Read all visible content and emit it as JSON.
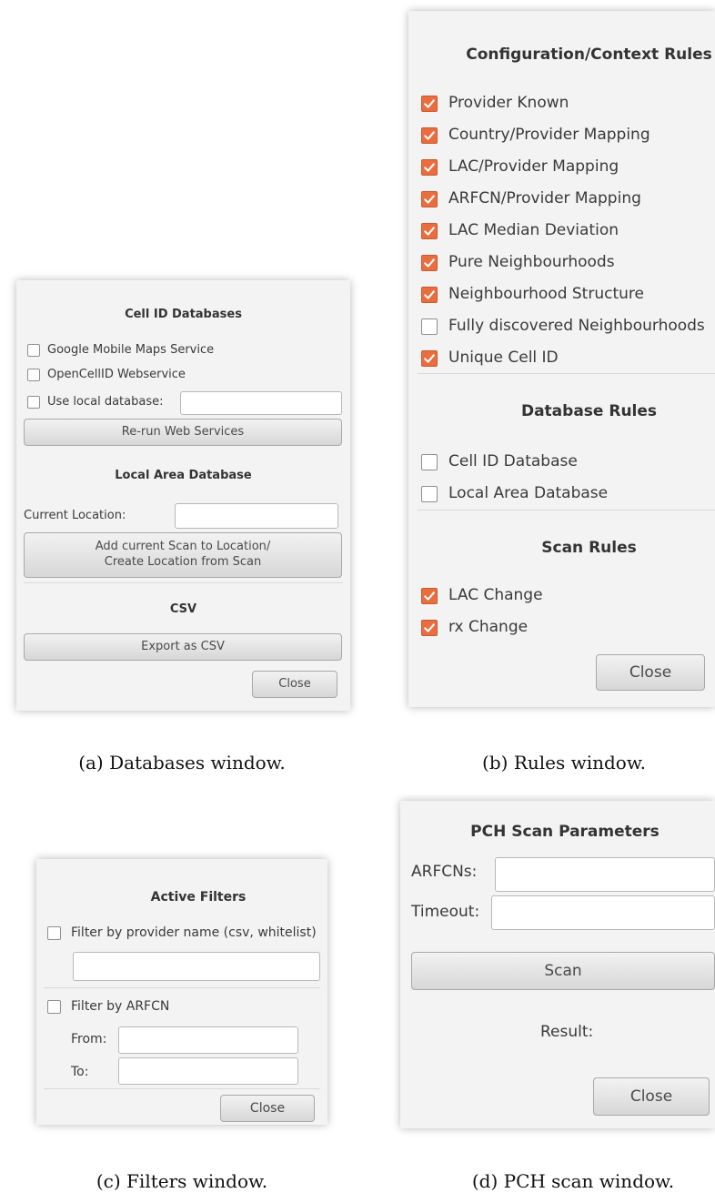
{
  "databases_window": {
    "title": "Cell ID Databases",
    "google_label": "Google Mobile Maps Service",
    "opencellid_label": "OpenCellID Webservice",
    "use_local_label": "Use local database:",
    "use_local_value": "",
    "rerun_button": "Re-run Web Services",
    "local_area_title": "Local Area Database",
    "current_location_label": "Current Location:",
    "current_location_value": "",
    "add_scan_line1": "Add current Scan to Location/",
    "add_scan_line2": "Create Location from Scan",
    "csv_title": "CSV",
    "export_button": "Export as CSV",
    "close_button": "Close"
  },
  "rules_window": {
    "config_title": "Configuration/Context Rules",
    "config_rules": [
      {
        "label": "Provider Known",
        "checked": true
      },
      {
        "label": "Country/Provider Mapping",
        "checked": true
      },
      {
        "label": "LAC/Provider Mapping",
        "checked": true
      },
      {
        "label": "ARFCN/Provider Mapping",
        "checked": true
      },
      {
        "label": "LAC Median Deviation",
        "checked": true
      },
      {
        "label": "Pure Neighbourhoods",
        "checked": true
      },
      {
        "label": "Neighbourhood Structure",
        "checked": true
      },
      {
        "label": "Fully discovered Neighbourhoods",
        "checked": false
      },
      {
        "label": "Unique Cell ID",
        "checked": true
      }
    ],
    "database_title": "Database Rules",
    "database_rules": [
      {
        "label": "Cell ID Database",
        "checked": false
      },
      {
        "label": "Local Area Database",
        "checked": false
      }
    ],
    "scan_title": "Scan Rules",
    "scan_rules": [
      {
        "label": "LAC Change",
        "checked": true
      },
      {
        "label": "rx Change",
        "checked": true
      }
    ],
    "close_button": "Close"
  },
  "filters_window": {
    "title": "Active Filters",
    "provider_filter_label": "Filter by provider name (csv, whitelist)",
    "provider_filter_value": "",
    "arfcn_filter_label": "Filter by ARFCN",
    "from_label": "From:",
    "from_value": "",
    "to_label": "To:",
    "to_value": "",
    "close_button": "Close"
  },
  "pch_window": {
    "title": "PCH Scan Parameters",
    "arfcns_label": "ARFCNs:",
    "arfcns_value": "",
    "timeout_label": "Timeout:",
    "timeout_value": "",
    "scan_button": "Scan",
    "result_label": "Result:",
    "close_button": "Close"
  },
  "captions": {
    "a": "(a)  Databases window.",
    "b": "(b)  Rules window.",
    "c": "(c)  Filters window.",
    "d": "(d)  PCH scan window."
  },
  "colors": {
    "checkbox_checked": "#e96d3f",
    "window_bg": "#f3f3f3"
  }
}
